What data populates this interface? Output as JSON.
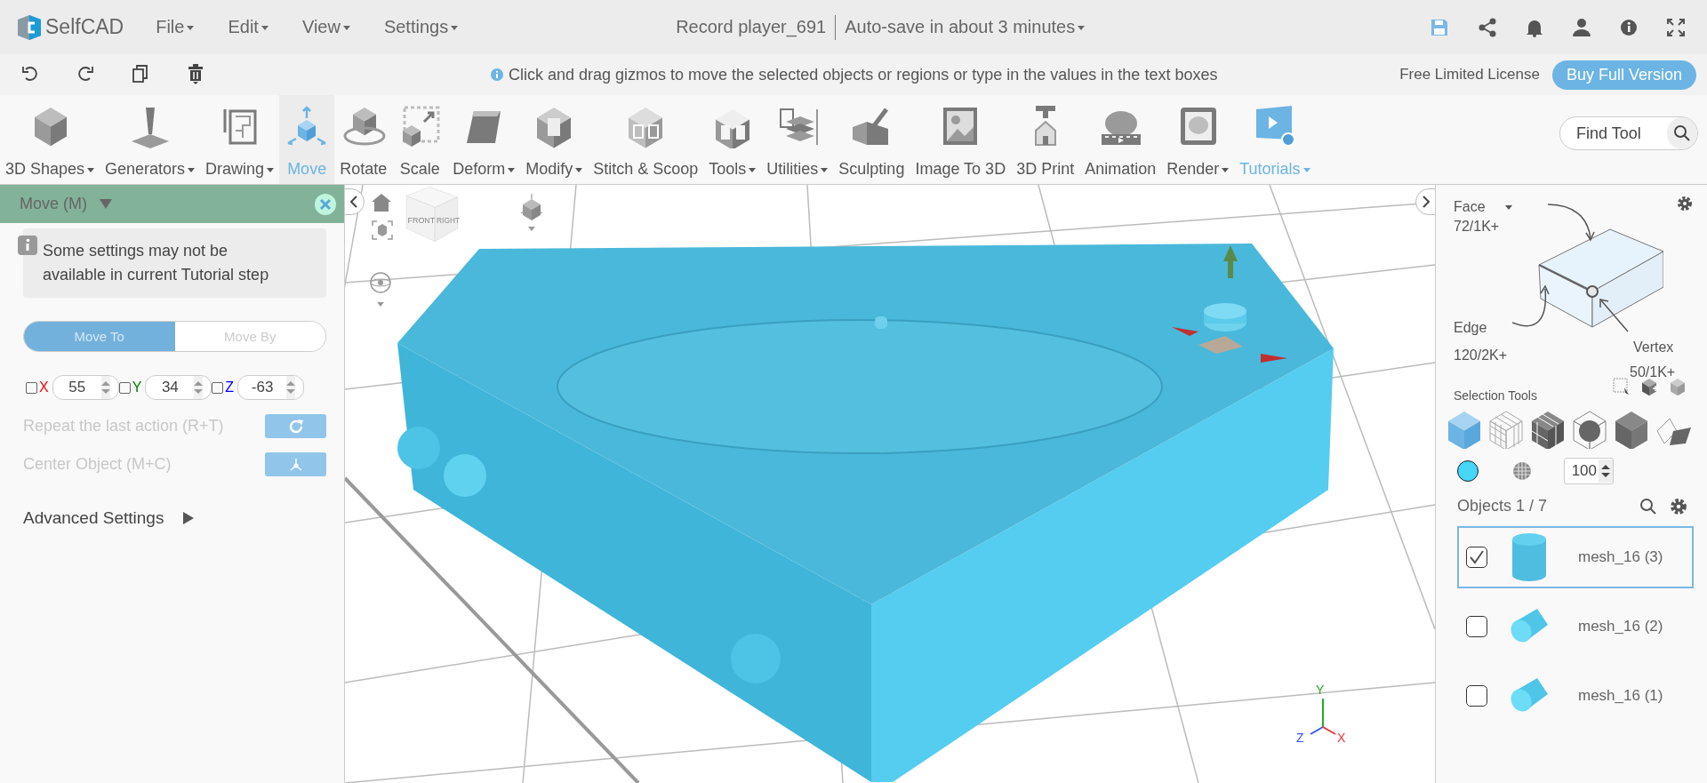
{
  "app": {
    "logo_text": "SelfCAD"
  },
  "menu": [
    {
      "label": "File"
    },
    {
      "label": "Edit"
    },
    {
      "label": "View"
    },
    {
      "label": "Settings"
    }
  ],
  "document": {
    "title": "Record player_691",
    "autosave": "Auto-save in about 3 minutes"
  },
  "hint": "Click and drag gizmos to move the selected objects or regions or type in the values in the text boxes",
  "license": {
    "label": "Free Limited License",
    "button": "Buy Full Version"
  },
  "tools": [
    {
      "label": "3D Shapes",
      "dropdown": true,
      "selected": false,
      "accent": false
    },
    {
      "label": "Generators",
      "dropdown": true,
      "selected": false,
      "accent": false
    },
    {
      "label": "Drawing",
      "dropdown": true,
      "selected": false,
      "accent": false
    },
    {
      "label": "Move",
      "dropdown": false,
      "selected": true,
      "accent": false
    },
    {
      "label": "Rotate",
      "dropdown": false,
      "selected": false,
      "accent": false
    },
    {
      "label": "Scale",
      "dropdown": false,
      "selected": false,
      "accent": false
    },
    {
      "label": "Deform",
      "dropdown": true,
      "selected": false,
      "accent": false
    },
    {
      "label": "Modify",
      "dropdown": true,
      "selected": false,
      "accent": false
    },
    {
      "label": "Stitch & Scoop",
      "dropdown": false,
      "selected": false,
      "accent": false
    },
    {
      "label": "Tools",
      "dropdown": true,
      "selected": false,
      "accent": false
    },
    {
      "label": "Utilities",
      "dropdown": true,
      "selected": false,
      "accent": false
    },
    {
      "label": "Sculpting",
      "dropdown": false,
      "selected": false,
      "accent": false
    },
    {
      "label": "Image To 3D",
      "dropdown": false,
      "selected": false,
      "accent": false
    },
    {
      "label": "3D Print",
      "dropdown": false,
      "selected": false,
      "accent": false
    },
    {
      "label": "Animation",
      "dropdown": false,
      "selected": false,
      "accent": false
    },
    {
      "label": "Render",
      "dropdown": true,
      "selected": false,
      "accent": false
    },
    {
      "label": "Tutorials",
      "dropdown": true,
      "selected": false,
      "accent": true
    }
  ],
  "find_tool": {
    "placeholder": "Find Tool"
  },
  "panel": {
    "title": "Move (M)",
    "notice": "Some settings may not be available in current Tutorial step",
    "modes": [
      {
        "label": "Move To",
        "selected": true
      },
      {
        "label": "Move By",
        "selected": false
      }
    ],
    "axes": [
      {
        "axis": "X",
        "value": "55",
        "checked": false,
        "color": "#ff0000"
      },
      {
        "axis": "Y",
        "value": "34",
        "checked": false,
        "color": "#008000"
      },
      {
        "axis": "Z",
        "value": "-63",
        "checked": false,
        "color": "#0000ff"
      }
    ],
    "actions": [
      {
        "label": "Repeat the last action (R+T)",
        "disabled": true
      },
      {
        "label": "Center Object (M+C)",
        "disabled": true
      }
    ],
    "advanced": "Advanced Settings"
  },
  "viewport": {
    "cube_labels": [
      "FRONT",
      "RIGHT"
    ],
    "gizmo_axes": [
      {
        "label": "Y",
        "color": "#22aa22"
      },
      {
        "label": "Z",
        "color": "#3355ee"
      },
      {
        "label": "X",
        "color": "#ee3333"
      }
    ]
  },
  "selection": {
    "face": {
      "label": "Face",
      "count": "72/1K+"
    },
    "edge": {
      "label": "Edge",
      "count": "120/2K+"
    },
    "vertex": {
      "label": "Vertex",
      "count": "50/1K+"
    },
    "tools_label": "Selection Tools",
    "modes": [
      {
        "selected": true
      },
      {
        "selected": false
      },
      {
        "selected": false
      },
      {
        "selected": false
      },
      {
        "selected": false
      },
      {
        "selected": false
      }
    ],
    "color": "#45d6f8",
    "opacity": "100"
  },
  "objects": {
    "title": "Objects 1 / 7",
    "items": [
      {
        "name": "mesh_16 (3)",
        "checked": true,
        "selected": true
      },
      {
        "name": "mesh_16 (2)",
        "checked": false,
        "selected": false
      },
      {
        "name": "mesh_16 (1)",
        "checked": false,
        "selected": false
      }
    ]
  }
}
